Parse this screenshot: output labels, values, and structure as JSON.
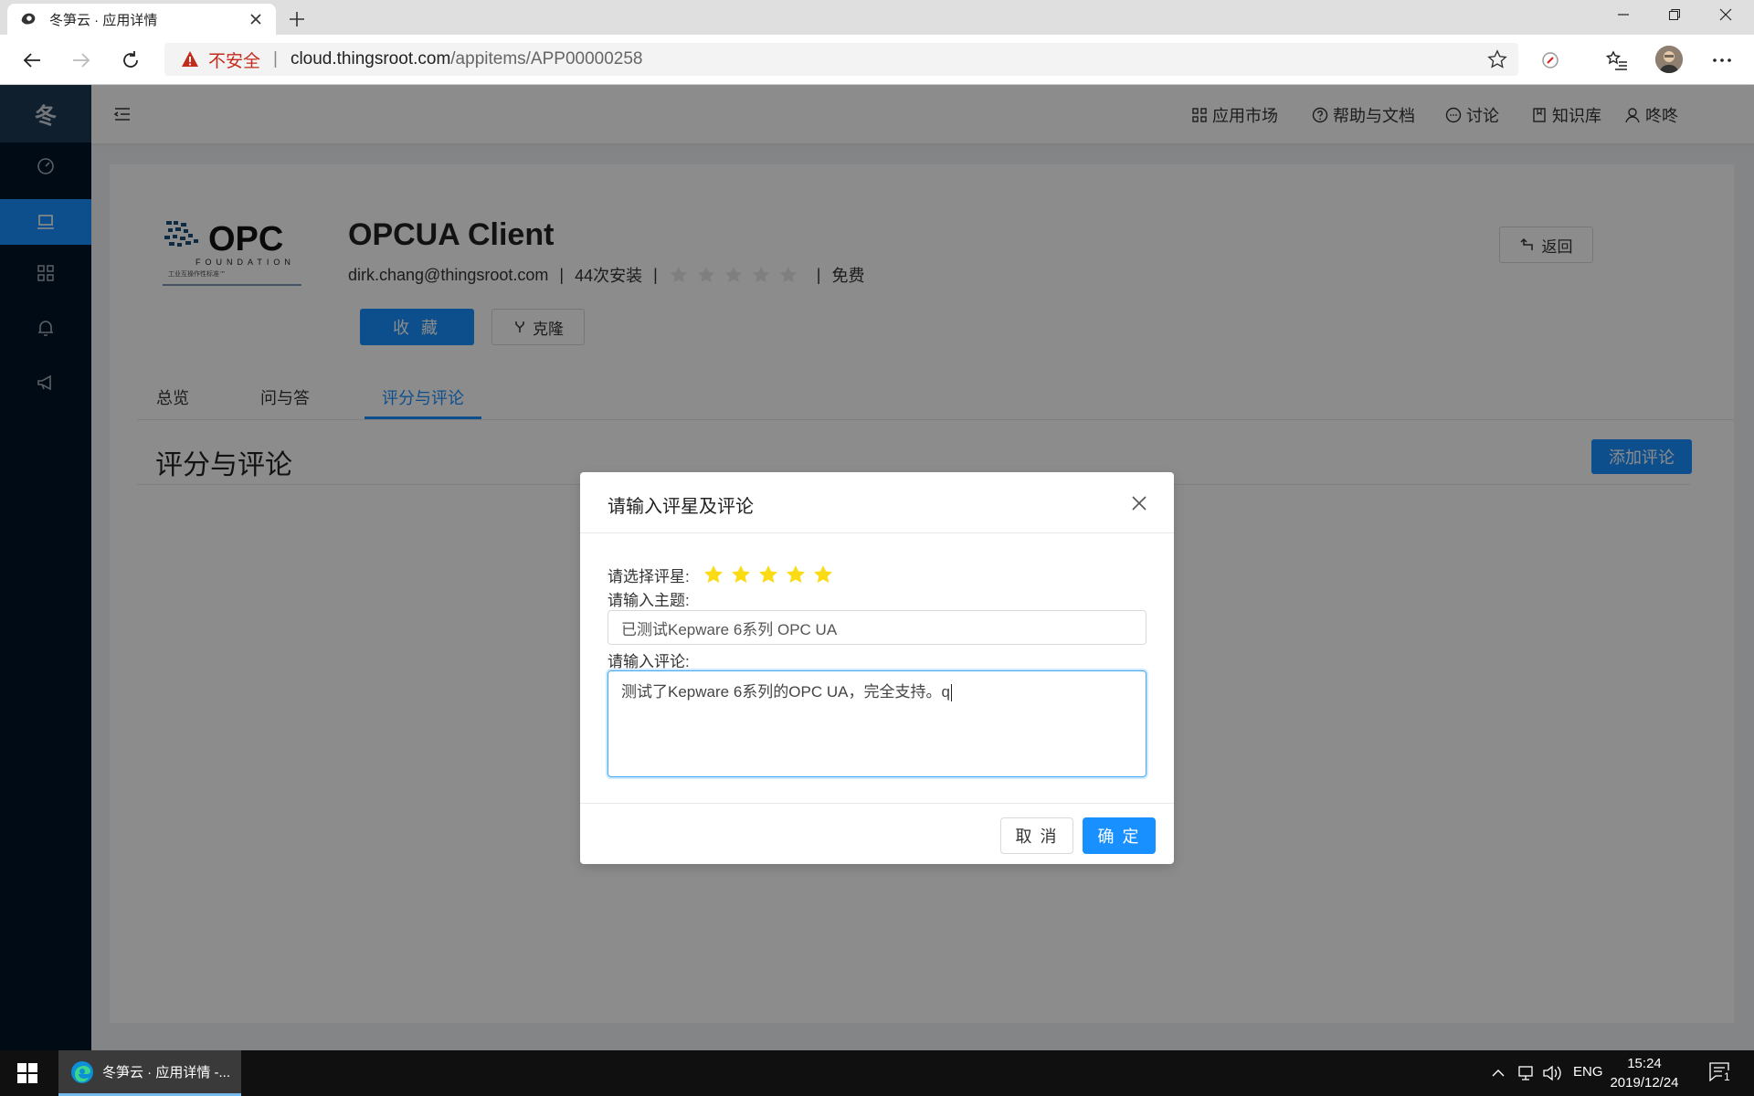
{
  "browser": {
    "tab_title": "冬笋云 · 应用详情",
    "url_security": "不安全",
    "url_host": "cloud.thingsroot.com",
    "url_path": "/appitems/APP00000258"
  },
  "app": {
    "logo_text": "冬",
    "header_nav": [
      "应用市场",
      "帮助与文档",
      "讨论",
      "知识库",
      "咚咚"
    ]
  },
  "detail": {
    "title": "OPCUA Client",
    "author": "dirk.chang@thingsroot.com",
    "installs": "44次安装",
    "price": "免费",
    "rating": 0,
    "favorite_label": "收 藏",
    "clone_label": "克隆",
    "back_label": "返回",
    "logo_brand": "OPC",
    "logo_sub": "FOUNDATION",
    "logo_tag": "工业互操作性标准™",
    "tabs": [
      "总览",
      "问与答",
      "评分与评论"
    ],
    "active_tab": "评分与评论",
    "section_title": "评分与评论",
    "add_review_label": "添加评论"
  },
  "modal": {
    "title": "请输入评星及评论",
    "rating_label": "请选择评星:",
    "rating_value": 5,
    "subject_label": "请输入主题:",
    "subject_value": "已测试Kepware 6系列 OPC UA",
    "comment_label": "请输入评论:",
    "comment_value": "测试了Kepware 6系列的OPC UA，完全支持。q",
    "cancel_label": "取 消",
    "ok_label": "确 定"
  },
  "taskbar": {
    "app_label": "冬笋云 · 应用详情 -...",
    "lang": "ENG",
    "time": "15:24",
    "date": "2019/12/24",
    "notif_count": "1"
  },
  "colors": {
    "primary": "#1890ff",
    "sidebar": "#001529",
    "star_yellow": "#fadb14"
  }
}
